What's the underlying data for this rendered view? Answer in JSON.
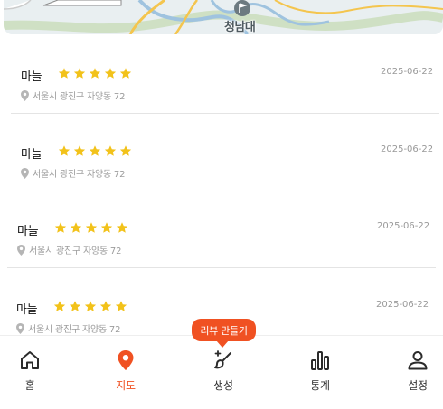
{
  "map": {
    "place_label": "청남대"
  },
  "records": [
    {
      "name": "마늘",
      "rating": 5,
      "date": "2025-06-22",
      "address": "서울시 광진구 자양동 72"
    },
    {
      "name": "마늘",
      "rating": 5,
      "date": "2025-06-22",
      "address": "서울시 광진구 자양동 72"
    },
    {
      "name": "마늘",
      "rating": 5,
      "date": "2025-06-22",
      "address": "서울시 광진구 자양동 72"
    },
    {
      "name": "마늘",
      "rating": 5,
      "date": "2025-06-22",
      "address": "서울시 광진구 자양동 72"
    }
  ],
  "tooltip": {
    "text": "리뷰 만들기"
  },
  "nav": {
    "items": [
      {
        "label": "홈",
        "icon": "home-icon",
        "active": false
      },
      {
        "label": "지도",
        "icon": "map-pin-icon",
        "active": true
      },
      {
        "label": "생성",
        "icon": "brush-sparkle-icon",
        "active": false
      },
      {
        "label": "통계",
        "icon": "bar-chart-icon",
        "active": false
      },
      {
        "label": "설정",
        "icon": "person-icon",
        "active": false
      }
    ]
  },
  "colors": {
    "accent": "#f05122",
    "star": "#f2c21a",
    "muted_text": "#9c9c9c",
    "divider": "#e4e4e4"
  }
}
